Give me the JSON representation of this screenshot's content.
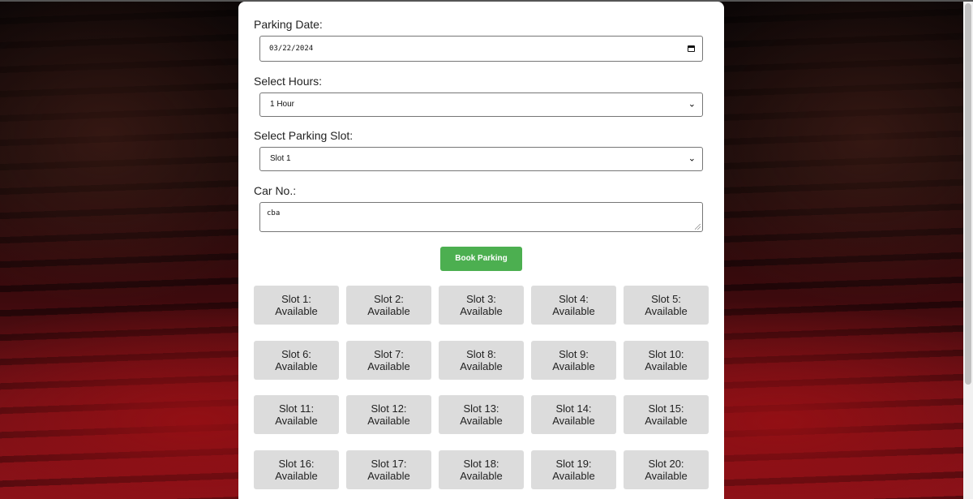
{
  "form": {
    "date_label": "Parking Date:",
    "date_value": "03/22/2024",
    "hours_label": "Select Hours:",
    "hours_value": "1 Hour",
    "slot_label": "Select Parking Slot:",
    "slot_value": "Slot 1",
    "car_label": "Car No.:",
    "car_value": "cba",
    "book_button": "Book Parking"
  },
  "icons": {
    "date": "calendar-icon",
    "hours": "chevron-down-icon",
    "slot": "chevron-down-icon",
    "car": "resize-handle-icon"
  },
  "colors": {
    "book_button": "#4caf50",
    "slot_background": "#dcdcdc"
  },
  "slots": [
    {
      "name": "Slot 1:",
      "status": "Available"
    },
    {
      "name": "Slot 2:",
      "status": "Available"
    },
    {
      "name": "Slot 3:",
      "status": "Available"
    },
    {
      "name": "Slot 4:",
      "status": "Available"
    },
    {
      "name": "Slot 5:",
      "status": "Available"
    },
    {
      "name": "Slot 6:",
      "status": "Available"
    },
    {
      "name": "Slot 7:",
      "status": "Available"
    },
    {
      "name": "Slot 8:",
      "status": "Available"
    },
    {
      "name": "Slot 9:",
      "status": "Available"
    },
    {
      "name": "Slot 10:",
      "status": "Available"
    },
    {
      "name": "Slot 11:",
      "status": "Available"
    },
    {
      "name": "Slot 12:",
      "status": "Available"
    },
    {
      "name": "Slot 13:",
      "status": "Available"
    },
    {
      "name": "Slot 14:",
      "status": "Available"
    },
    {
      "name": "Slot 15:",
      "status": "Available"
    },
    {
      "name": "Slot 16:",
      "status": "Available"
    },
    {
      "name": "Slot 17:",
      "status": "Available"
    },
    {
      "name": "Slot 18:",
      "status": "Available"
    },
    {
      "name": "Slot 19:",
      "status": "Available"
    },
    {
      "name": "Slot 20:",
      "status": "Available"
    }
  ]
}
